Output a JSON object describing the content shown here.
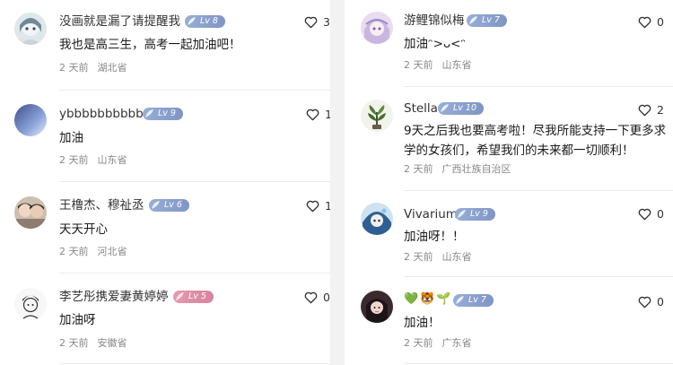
{
  "left_comments": [
    {
      "username": "没画就是漏了请提醒我",
      "level": "Lv 8",
      "badge": "blue",
      "text": "我也是高三生，高考一起加油吧！",
      "time": "2 天前",
      "location": "湖北省",
      "likes": "3",
      "avatar": "anime-girl-avatar"
    },
    {
      "username": "ybbbbbbbbbb",
      "level": "Lv 9",
      "badge": "blue",
      "text": "加油",
      "time": "2 天前",
      "location": "山东省",
      "likes": "1",
      "avatar": "gradient-avatar"
    },
    {
      "username": "王橹杰、穆祉丞",
      "level": "Lv 6",
      "badge": "blue",
      "text": "天天开心",
      "time": "2 天前",
      "location": "河北省",
      "likes": "1",
      "avatar": "photo-avatar"
    },
    {
      "username": "李艺彤携爱妻黄婷婷",
      "level": "Lv 5",
      "badge": "pink",
      "text": "加油呀",
      "time": "2 天前",
      "location": "安徽省",
      "likes": "0",
      "avatar": "sketch-avatar"
    }
  ],
  "right_comments": [
    {
      "username": "游鲤锦似梅",
      "level": "Lv 7",
      "badge": "blue",
      "text": "加油ᵔ>ᴗ<ᵔ",
      "time": "2 天前",
      "location": "山东省",
      "likes": "0",
      "avatar": "purple-anime-avatar"
    },
    {
      "username": "Stella",
      "level": "Lv 10",
      "badge": "blue",
      "text_lines": [
        "9天之后我也要高考啦！尽我所能支持一下更多求",
        "学的女孩们，希望我们的未来都一切顺利！"
      ],
      "time": "2 天前",
      "location": "广西壮族自治区",
      "likes": "2",
      "avatar": "plant-avatar"
    },
    {
      "username": "Vivarium",
      "level": "Lv 9",
      "badge": "blue",
      "text": "加油呀！！",
      "time": "2 天前",
      "location": "山东省",
      "likes": "0",
      "avatar": "blue-anime-avatar"
    },
    {
      "username_emojis": [
        "💚",
        "🐯",
        "🌱"
      ],
      "level": "Lv 7",
      "badge": "blue",
      "text": "加油！",
      "time": "2 天前",
      "location": "广东省",
      "likes": "0",
      "avatar": "girl-photo-avatar"
    }
  ]
}
